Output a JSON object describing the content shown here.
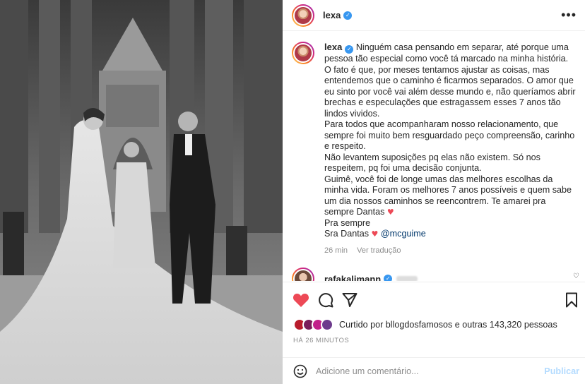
{
  "post": {
    "username": "lexa",
    "more_label": "•••"
  },
  "caption": {
    "username": "lexa",
    "lines": [
      "Ninguém casa pensando em separar, até porque uma pessoa tão especial como você tá marcado na minha história.",
      "O fato é que, por meses tentamos ajustar as coisas, mas entendemos que o caminho é ficarmos separados. O amor que eu sinto por você vai além desse mundo e, não queríamos abrir brechas e especulações que estragassem esses 7 anos tão lindos vividos.",
      "Para todos que acompanharam nosso relacionamento, que sempre foi muito bem resguardado peço compreensão, carinho e respeito.",
      "Não levantem suposições pq elas não existem. Só nos respeitem, pq foi uma decisão conjunta.",
      "Guimê, você foi de longe umas das melhores escolhas da minha vida. Foram os melhores 7 anos possíveis e quem sabe um dia nossos caminhos se reencontrem. Te amarei pra sempre Dantas",
      "Pra sempre",
      "Sra Dantas"
    ],
    "heart": "♥",
    "mention": "@mcguime",
    "time": "26 min",
    "translate": "Ver tradução"
  },
  "comment2": {
    "username": "rafakalimann"
  },
  "likes": {
    "text": "Curtido por bllogdosfamosos e outras 143,320 pessoas"
  },
  "timestamp": "HÁ 26 MINUTOS",
  "add_comment": {
    "placeholder": "Adicione um comentário...",
    "publish": "Publicar"
  },
  "colors": {
    "like_red": "#ed4956",
    "verified_blue": "#3897f0",
    "publish_disabled": "#b3dbff"
  }
}
